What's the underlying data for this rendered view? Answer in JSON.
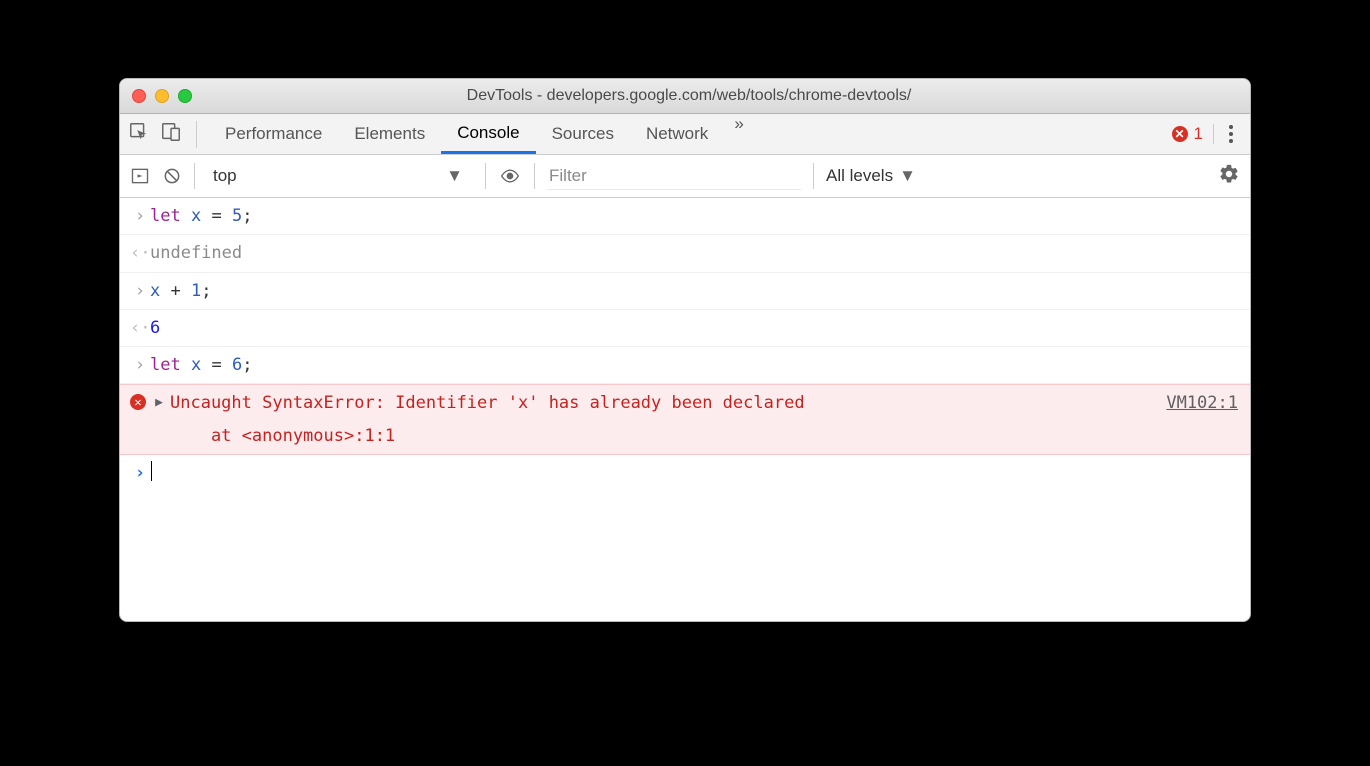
{
  "window": {
    "title": "DevTools - developers.google.com/web/tools/chrome-devtools/"
  },
  "tabs": {
    "items": [
      "Performance",
      "Elements",
      "Console",
      "Sources",
      "Network"
    ],
    "active_index": 2,
    "overflow_glyph": "»"
  },
  "errors": {
    "count": "1",
    "badge_glyph": "✕"
  },
  "toolbar": {
    "context": "top",
    "filter_placeholder": "Filter",
    "levels_label": "All levels"
  },
  "console": {
    "entries": [
      {
        "type": "input",
        "tokens": [
          [
            "kw",
            "let"
          ],
          [
            "op",
            " "
          ],
          [
            "ident",
            "x"
          ],
          [
            "op",
            " = "
          ],
          [
            "val",
            "5"
          ],
          [
            "op",
            ";"
          ]
        ]
      },
      {
        "type": "output",
        "text": "undefined",
        "dimmed": true
      },
      {
        "type": "input",
        "tokens": [
          [
            "ident",
            "x"
          ],
          [
            "op",
            " + "
          ],
          [
            "val",
            "1"
          ],
          [
            "op",
            ";"
          ]
        ]
      },
      {
        "type": "output",
        "text": "6",
        "numeric": true
      },
      {
        "type": "input",
        "tokens": [
          [
            "kw",
            "let"
          ],
          [
            "op",
            " "
          ],
          [
            "ident",
            "x"
          ],
          [
            "op",
            " = "
          ],
          [
            "val",
            "6"
          ],
          [
            "op",
            ";"
          ]
        ]
      }
    ],
    "error": {
      "message_line1": "Uncaught SyntaxError: Identifier 'x' has already been declared",
      "message_line2": "    at <anonymous>:1:1",
      "source": "VM102:1"
    }
  }
}
